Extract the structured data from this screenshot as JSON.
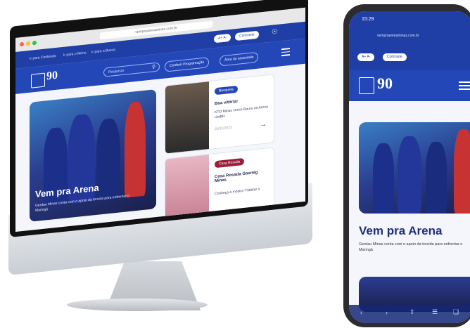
{
  "desktop": {
    "url": "vempraarenaminas.com.br",
    "accessibility": {
      "skip_content": "Ir para Conteúdo",
      "skip_menu": "Ir para o Menu",
      "skip_search": "Ir para a Busca",
      "font_controls": "A+  A-",
      "contrast": "Contraste"
    },
    "header": {
      "logo_text": "90",
      "search_placeholder": "Pesquisar",
      "program_button": "Conferir Programação",
      "member_button": "Área do associado"
    },
    "hero": {
      "title": "Vem pra Arena",
      "subtitle": "Gerdau Minas conta com o apoio da torcida para enfrentar o Maringá"
    },
    "cards": [
      {
        "badge": "Basquete",
        "badge_color": "#2447b8",
        "title": "Boa vitória!",
        "text": "KTO Minas vence Bauru na Arena UniBH",
        "date": "20/11/2023"
      },
      {
        "badge": "Casa Rosada",
        "badge_color": "#9b1f3d",
        "title": "Casa Rosada Gasmig Minas",
        "text": "Conheça a mostra \"Habitar o",
        "date": ""
      }
    ]
  },
  "phone": {
    "time": "15:29",
    "url": "vempraarenaminas.com.br",
    "contrast": "Contraste",
    "font_controls": "A+ A-",
    "logo_text": "90",
    "hero_title": "Vem pra Arena",
    "hero_subtitle": "Gerdau Minas conta com o apoio da torcida para enfrentar o Maringá"
  },
  "colors": {
    "primary": "#2447b8",
    "top_bar": "#1f3fa6",
    "title_dark": "#1d2f7a"
  }
}
